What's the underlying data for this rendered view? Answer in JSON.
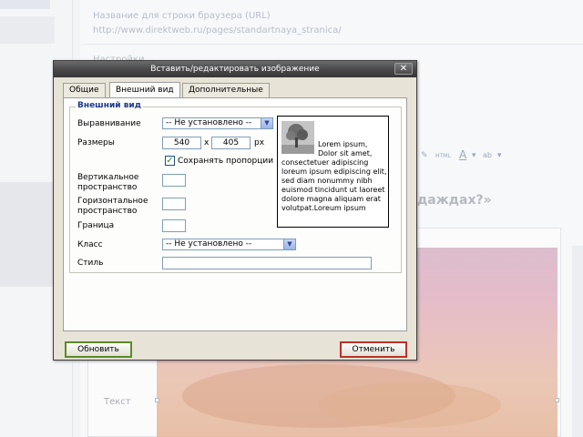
{
  "background": {
    "field_title_label": "Название для строки браузера (URL)",
    "field_url_value": "http://www.direktweb.ru/pages/standartnaya_stranica/",
    "settings_label": "Настройки",
    "heading_fragment": "даждах?»",
    "text_label": "Текст",
    "toolbar_html": "HTML"
  },
  "dialog": {
    "title": "Вставить/редактировать изображение",
    "close_symbol": "✕",
    "tabs": [
      {
        "label": "Общие",
        "active": false
      },
      {
        "label": "Внешний вид",
        "active": true
      },
      {
        "label": "Дополнительные",
        "active": false
      }
    ],
    "fieldset_legend": "Внешний вид",
    "alignment": {
      "label": "Выравнивание",
      "value": "-- Не установлено --"
    },
    "dimensions": {
      "label": "Размеры",
      "width": "540",
      "separator": "x",
      "height": "405",
      "unit": "px"
    },
    "keep_proportions": {
      "label": "Сохранять пропорции",
      "checked": true
    },
    "vspace": {
      "label_line1": "Вертикальное",
      "label_line2": "пространство",
      "value": ""
    },
    "hspace": {
      "label_line1": "Горизонтальное",
      "label_line2": "пространство",
      "value": ""
    },
    "border": {
      "label": "Граница",
      "value": ""
    },
    "class": {
      "label": "Класс",
      "value": "-- Не установлено --"
    },
    "style": {
      "label": "Стиль",
      "value": ""
    },
    "preview_text": "Lorem ipsum, Dolor sit amet, consectetuer adipiscing loreum ipsum edipiscing elit, sed diam nonummy nibh euismod tincidunt ut laoreet dolore magna aliquam erat volutpat.Loreum ipsum",
    "buttons": {
      "update": "Обновить",
      "cancel": "Отменить"
    }
  },
  "colors": {
    "title_bar": "#4a4a4a",
    "legend_text": "#1c3a8c",
    "update_border": "#5a8a2a",
    "cancel_border": "#b8322a"
  }
}
